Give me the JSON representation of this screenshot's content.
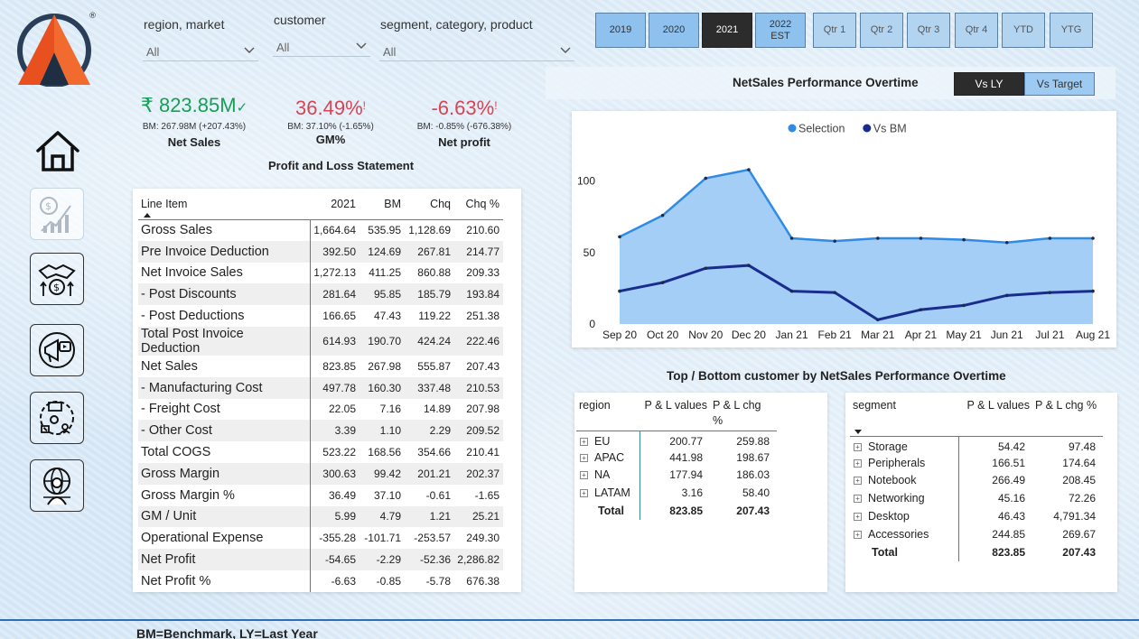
{
  "filters": {
    "region": {
      "label": "region, market",
      "value": "All"
    },
    "customer": {
      "label": "customer",
      "value": "All"
    },
    "segment": {
      "label": "segment, category, product",
      "value": "All"
    }
  },
  "years": [
    {
      "label": "2019",
      "selected": false
    },
    {
      "label": "2020",
      "selected": false
    },
    {
      "label": "2021",
      "selected": true
    },
    {
      "label": "2022\nEST",
      "selected": false
    }
  ],
  "quarters": [
    "Qtr 1",
    "Qtr 2",
    "Qtr 3",
    "Qtr 4",
    "YTD",
    "YTG"
  ],
  "kpis": {
    "net_sales": {
      "value": "₹ 823.85M",
      "bm": "BM: 267.98M (+207.43%)",
      "label": "Net Sales"
    },
    "gm": {
      "value": "36.49%",
      "bm": "BM: 37.10% (-1.65%)",
      "label": "GM%"
    },
    "net_profit": {
      "value": "-6.63%",
      "bm": "BM: -0.85% (-676.38%)",
      "label": "Net profit"
    }
  },
  "pl_title": "Profit and Loss Statement",
  "pl_table": {
    "headers": [
      "Line Item",
      "2021",
      "BM",
      "Chq",
      "Chq %"
    ],
    "rows": [
      [
        "Gross Sales",
        "1,664.64",
        "535.95",
        "1,128.69",
        "210.60"
      ],
      [
        "Pre Invoice Deduction",
        "392.50",
        "124.69",
        "267.81",
        "214.77"
      ],
      [
        "Net Invoice Sales",
        "1,272.13",
        "411.25",
        "860.88",
        "209.33"
      ],
      [
        "- Post Discounts",
        "281.64",
        "95.85",
        "185.79",
        "193.84"
      ],
      [
        "- Post Deductions",
        "166.65",
        "47.43",
        "119.22",
        "251.38"
      ],
      [
        "Total Post Invoice Deduction",
        "614.93",
        "190.70",
        "424.24",
        "222.46"
      ],
      [
        "Net Sales",
        "823.85",
        "267.98",
        "555.87",
        "207.43"
      ],
      [
        "- Manufacturing Cost",
        "497.78",
        "160.30",
        "337.48",
        "210.53"
      ],
      [
        "- Freight Cost",
        "22.05",
        "7.16",
        "14.89",
        "207.98"
      ],
      [
        "- Other Cost",
        "3.39",
        "1.10",
        "2.29",
        "209.52"
      ],
      [
        "Total COGS",
        "523.22",
        "168.56",
        "354.66",
        "210.41"
      ],
      [
        "Gross Margin",
        "300.63",
        "99.42",
        "201.21",
        "202.37"
      ],
      [
        "Gross Margin %",
        "36.49",
        "37.10",
        "-0.61",
        "-1.65"
      ],
      [
        "GM / Unit",
        "5.99",
        "4.79",
        "1.21",
        "25.21"
      ],
      [
        "Operational Expense",
        "-355.28",
        "-101.71",
        "-253.57",
        "249.30"
      ],
      [
        "Net Profit",
        "-54.65",
        "-2.29",
        "-52.36",
        "2,286.82"
      ],
      [
        "Net Profit %",
        "-6.63",
        "-0.85",
        "-5.78",
        "676.38"
      ]
    ]
  },
  "chart_header": {
    "title": "NetSales Performance Overtime",
    "toggle_ly": "Vs LY",
    "toggle_target": "Vs Target"
  },
  "chart_data": {
    "type": "area",
    "x": [
      "Sep 20",
      "Oct 20",
      "Nov 20",
      "Dec 20",
      "Jan 21",
      "Feb 21",
      "Mar 21",
      "Apr 21",
      "May 21",
      "Jun 21",
      "Jul 21",
      "Aug 21"
    ],
    "series": [
      {
        "name": "Selection",
        "color": "#2f8be6",
        "values": [
          61,
          76,
          102,
          108,
          60,
          58,
          60,
          60,
          59,
          57,
          60,
          60
        ]
      },
      {
        "name": "Vs BM",
        "color": "#1a2d8f",
        "values": [
          23,
          29,
          39,
          41,
          23,
          22,
          3,
          10,
          13,
          20,
          22,
          23
        ]
      }
    ],
    "yticks": [
      0,
      50,
      100
    ],
    "ylim": [
      0,
      120
    ],
    "legend": "top-center",
    "fill_color": "#9fcbf5"
  },
  "bottom_title": "Top / Bottom customer by NetSales Performance Overtime",
  "region_table": {
    "headers": [
      "region",
      "P & L values",
      "P & L chg %"
    ],
    "rows": [
      [
        "EU",
        "200.77",
        "259.88"
      ],
      [
        "APAC",
        "441.98",
        "198.67"
      ],
      [
        "NA",
        "177.94",
        "186.03"
      ],
      [
        "LATAM",
        "3.16",
        "58.40"
      ]
    ],
    "total": [
      "Total",
      "823.85",
      "207.43"
    ]
  },
  "segment_table": {
    "headers": [
      "segment",
      "P & L values",
      "P & L chg %"
    ],
    "rows": [
      [
        "Storage",
        "54.42",
        "97.48"
      ],
      [
        "Peripherals",
        "166.51",
        "174.64"
      ],
      [
        "Notebook",
        "266.49",
        "208.45"
      ],
      [
        "Networking",
        "45.16",
        "72.26"
      ],
      [
        "Desktop",
        "46.43",
        "4,791.34"
      ],
      [
        "Accessories",
        "244.85",
        "269.67"
      ]
    ],
    "total": [
      "Total",
      "823.85",
      "207.43"
    ]
  },
  "footer": "BM=Benchmark, LY=Last Year",
  "colors": {
    "accent": "#3a8b9a",
    "year_btn": "#8ec1ee",
    "selected_btn": "#2c2c2c"
  }
}
